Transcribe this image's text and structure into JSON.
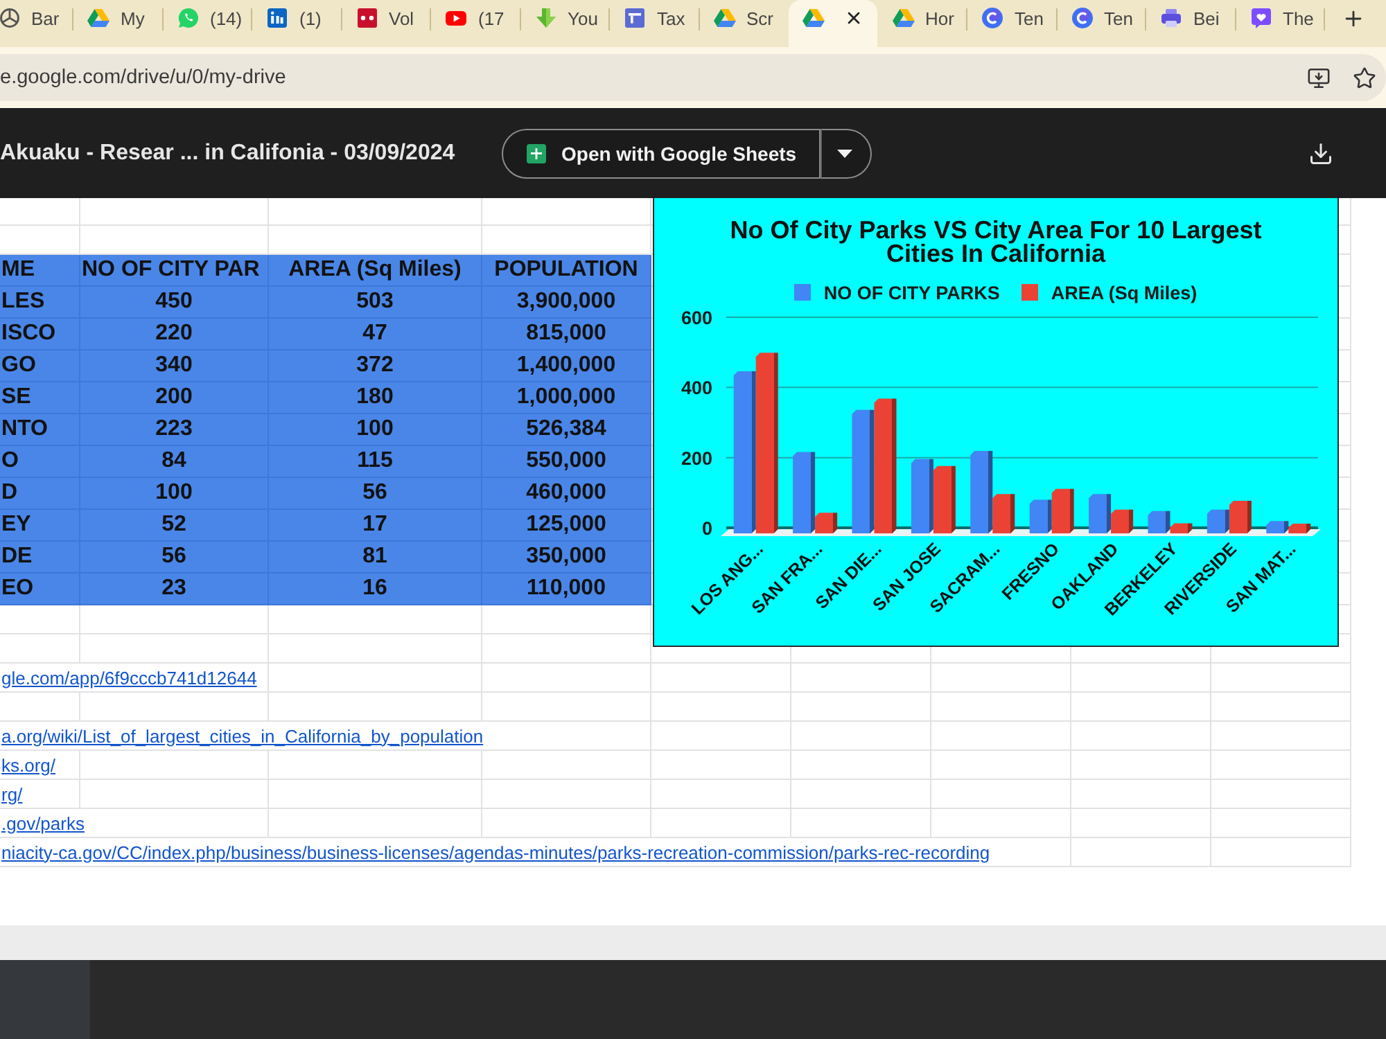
{
  "browser": {
    "tabs": [
      {
        "kind": "knot",
        "label": "Bar",
        "selected": false
      },
      {
        "kind": "triangle",
        "label": "My",
        "selected": false
      },
      {
        "kind": "chat",
        "label": "(14)",
        "selected": false
      },
      {
        "kind": "in-square",
        "label": "(1)",
        "selected": false
      },
      {
        "kind": "red-square",
        "label": "Vol",
        "selected": false
      },
      {
        "kind": "play",
        "label": "(17",
        "selected": false
      },
      {
        "kind": "arrow",
        "label": "You",
        "selected": false
      },
      {
        "kind": "tc-square",
        "label": "Tax",
        "selected": false
      },
      {
        "kind": "triangle",
        "label": "Scr",
        "selected": false
      },
      {
        "kind": "triangle",
        "selected": true
      },
      {
        "kind": "triangle",
        "label": "Hor",
        "selected": false
      },
      {
        "kind": "c-circle",
        "label": "Ten",
        "selected": false
      },
      {
        "kind": "c-circle",
        "label": "Ten",
        "selected": false
      },
      {
        "kind": "printer",
        "label": "Bei",
        "selected": false
      },
      {
        "kind": "heart-bubble",
        "label": "The",
        "selected": false
      }
    ],
    "address": "e.google.com/drive/u/0/my-drive"
  },
  "viewer": {
    "title": "Akuaku - Resear ... in Califonia - 03/09/2024",
    "open_button": "Open with Google Sheets"
  },
  "sheet": {
    "table": {
      "columns": [
        "ME",
        "NO OF CITY PAR",
        "AREA (Sq Miles)",
        "POPULATION"
      ],
      "rows": [
        [
          "LES",
          "450",
          "503",
          "3,900,000"
        ],
        [
          "ISCO",
          "220",
          "47",
          "815,000"
        ],
        [
          "GO",
          "340",
          "372",
          "1,400,000"
        ],
        [
          "SE",
          "200",
          "180",
          "1,000,000"
        ],
        [
          "NTO",
          "223",
          "100",
          "526,384"
        ],
        [
          "O",
          "84",
          "115",
          "550,000"
        ],
        [
          "D",
          "100",
          "56",
          "460,000"
        ],
        [
          "EY",
          "52",
          "17",
          "125,000"
        ],
        [
          "DE",
          "56",
          "81",
          "350,000"
        ],
        [
          "EO",
          "23",
          "16",
          "110,000"
        ]
      ]
    },
    "links": [
      "gle.com/app/6f9cccb741d12644",
      "a.org/wiki/List_of_largest_cities_in_California_by_population",
      "ks.org/",
      "rg/",
      ".gov/parks",
      "niacity-ca.gov/CC/index.php/business/business-licenses/agendas-minutes/parks-recreation-commission/parks-rec-recording"
    ],
    "chart": {
      "chart_data": {
        "type": "bar",
        "title": "No Of City Parks VS City Area For 10 Largest Cities In California",
        "legend": "top",
        "categories": [
          "LOS ANG...",
          "SAN FRA...",
          "SAN DIE...",
          "SAN JOSE",
          "SACRAM...",
          "FRESNO",
          "OAKLAND",
          "BERKELEY",
          "RIVERSIDE",
          "SAN MAT..."
        ],
        "series": [
          {
            "name": "NO OF CITY PARKS",
            "color": "#4285f4",
            "values": [
              450,
              220,
              340,
              200,
              223,
              84,
              100,
              52,
              56,
              23
            ]
          },
          {
            "name": "AREA (Sq Miles)",
            "color": "#ea4335",
            "values": [
              503,
              47,
              372,
              180,
              100,
              115,
              56,
              17,
              81,
              16
            ]
          }
        ],
        "ylim": [
          0,
          600
        ],
        "yticks": [
          0,
          200,
          400,
          600
        ]
      }
    }
  }
}
